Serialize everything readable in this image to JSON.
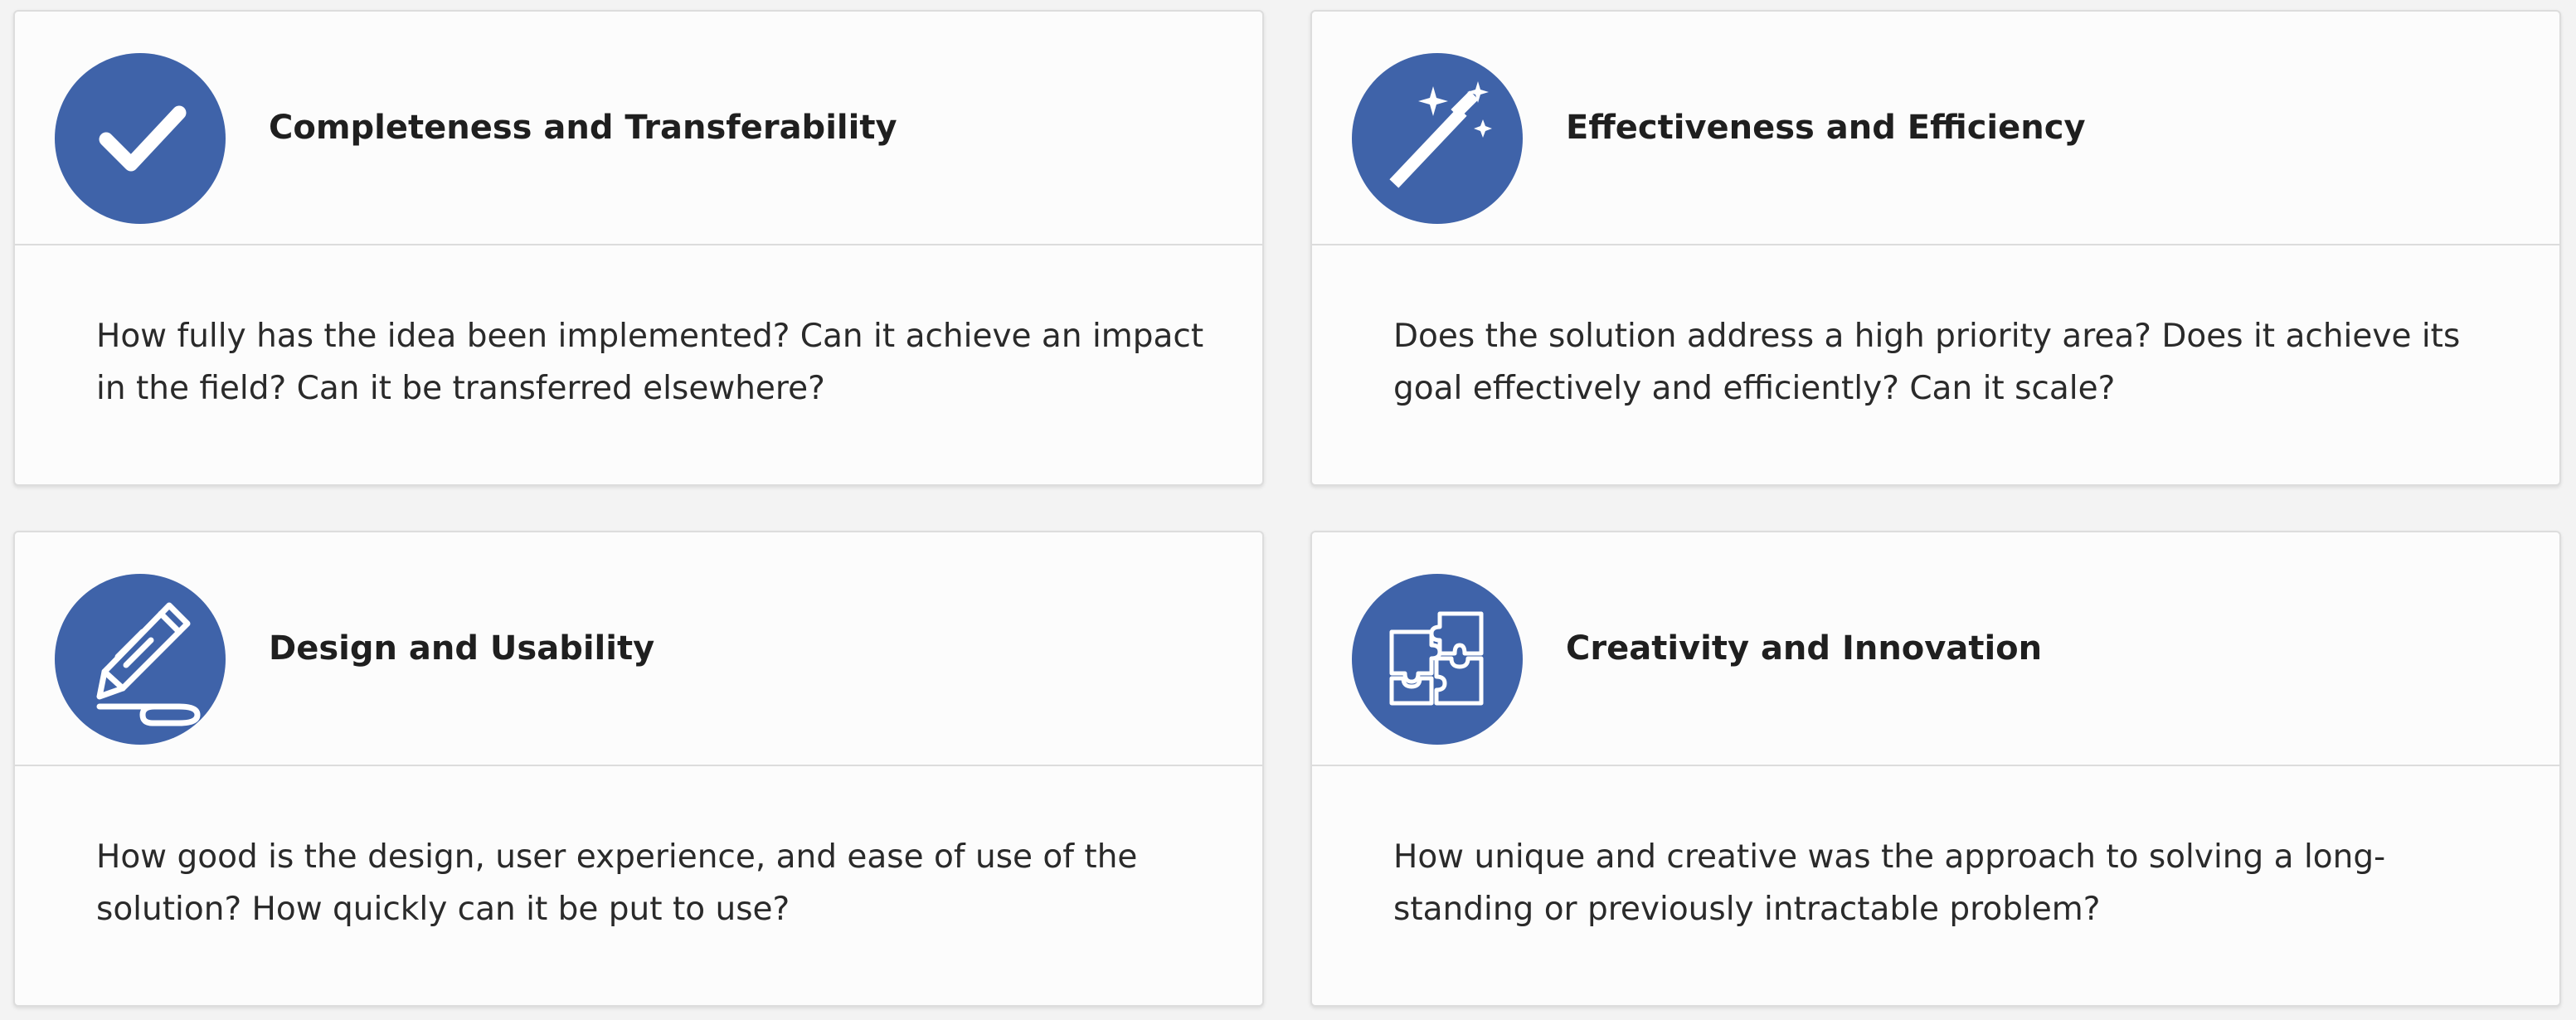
{
  "cards": [
    {
      "icon": "checkmark-icon",
      "title": "Completeness and Transferability",
      "description": "How fully has the idea been implemented? Can it achieve an impact in the field? Can it be transferred elsewhere?"
    },
    {
      "icon": "magic-wand-icon",
      "title": "Effectiveness and Efficiency",
      "description": "Does the solution address a high priority area? Does it achieve its goal effectively and efficiently? Can it scale?"
    },
    {
      "icon": "pencil-icon",
      "title": "Design and Usability",
      "description": "How good is the design, user experience, and ease of use of the solution? How quickly can it be put to use?"
    },
    {
      "icon": "puzzle-icon",
      "title": "Creativity and Innovation",
      "description": "How unique and creative was the approach to solving a long-standing or previously intractable problem?"
    }
  ],
  "colors": {
    "accent": "#3f63a9",
    "card_background": "#fcfcfc",
    "page_background": "#f3f3f3",
    "title_text": "#1f1f1f",
    "body_text": "#2a2a2a"
  }
}
